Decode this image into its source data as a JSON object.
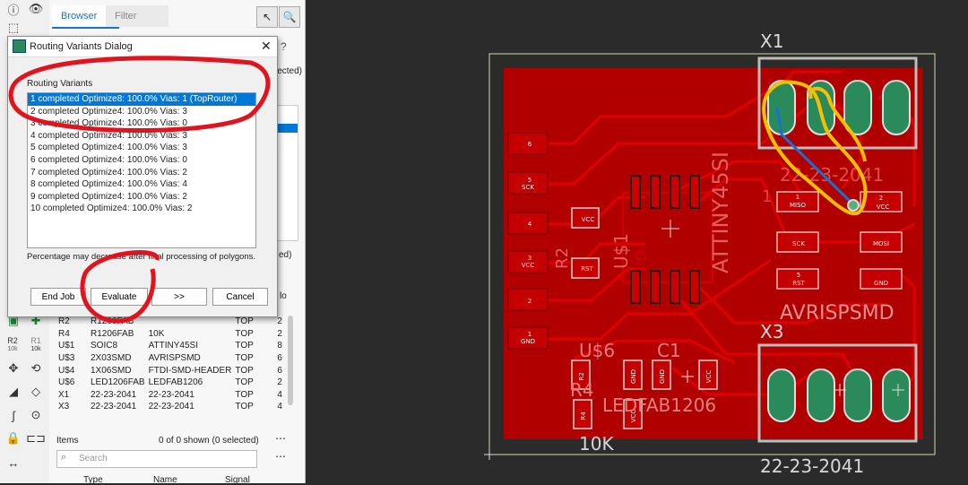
{
  "browser": {
    "tabs": [
      "Browser",
      "Filter"
    ],
    "partial_texts": {
      "selected": "lected)",
      "lines": "ed)",
      "lo": "lo"
    }
  },
  "parts_table": {
    "rows": [
      [
        "R2",
        "R1206FAB",
        "",
        "TOP",
        "2"
      ],
      [
        "R4",
        "R1206FAB",
        "10K",
        "TOP",
        "2"
      ],
      [
        "U$1",
        "SOIC8",
        "ATTINY45SI",
        "TOP",
        "8"
      ],
      [
        "U$3",
        "2X03SMD",
        "AVRISPSMD",
        "TOP",
        "6"
      ],
      [
        "U$4",
        "1X06SMD",
        "FTDI-SMD-HEADER",
        "TOP",
        "6"
      ],
      [
        "U$6",
        "LED1206FAB",
        "LEDFAB1206",
        "TOP",
        "2"
      ],
      [
        "X1",
        "22-23-2041",
        "22-23-2041",
        "TOP",
        "4"
      ],
      [
        "X3",
        "22-23-2041",
        "22-23-2041",
        "TOP",
        "4"
      ]
    ]
  },
  "items": {
    "label": "Items",
    "count": "0 of 0 shown (0 selected)",
    "search_placeholder": "Search",
    "columns": [
      "Type",
      "Name",
      "Signal"
    ]
  },
  "dialog": {
    "title": "Routing Variants Dialog",
    "group_label": "Routing Variants",
    "variants": [
      "1 completed Optimize8:  100.0%  Vias: 1 (TopRouter)",
      "2 completed Optimize4:  100.0%  Vias: 3",
      "3 completed Optimize4:  100.0%  Vias: 0",
      "4 completed Optimize4:  100.0%  Vias: 3",
      "5 completed Optimize4:  100.0%  Vias: 3",
      "6 completed Optimize4:  100.0%  Vias: 0",
      "7 completed Optimize4:  100.0%  Vias: 2",
      "8 completed Optimize4:  100.0%  Vias: 4",
      "9 completed Optimize4:  100.0%  Vias: 2",
      "10 completed Optimize4:  100.0%  Vias: 2"
    ],
    "note": "Percentage may decrease after final processing of polygons.",
    "buttons": {
      "end_job": "End Job",
      "evaluate": "Evaluate",
      "next": ">>",
      "cancel": "Cancel"
    }
  },
  "board_labels": {
    "x1": "X1",
    "x3": "X3",
    "x1_value": "22-23-2041",
    "x1_value_ghost": "22-23-2041",
    "avrisp": "AVRISPSMD",
    "attiny": "ATTINY45SI",
    "u1": "U$1",
    "u6": "U$6",
    "c1": "C1",
    "r2": "R2",
    "r4": "R4",
    "ledfab": "LEDFAB1206",
    "tenk": "10K",
    "one_ghost": "1"
  },
  "pads": {
    "ftdi": [
      "6",
      "5",
      "4",
      "3",
      "2",
      "1"
    ],
    "ftdi_names": [
      "",
      "SCK",
      "",
      "VCC",
      "",
      "GND"
    ],
    "avr": [
      "MISO",
      "VCC",
      "SCK",
      "MOSI",
      "RST",
      "GND"
    ],
    "avr_nums": [
      "1",
      "2",
      "",
      "",
      "5",
      ""
    ],
    "u1": [
      "VCC",
      "RST"
    ],
    "small": [
      "R2",
      "GND",
      "GND",
      "VCC",
      "R4",
      "VCC"
    ]
  },
  "toolbar_labels": {
    "r2": "R2",
    "r2_sub": "10k",
    "r1_sub": "10k"
  },
  "colors": {
    "board": "#b00000",
    "trace": "#e00000",
    "pad_green": "#2a8a5a",
    "annotation": "#e0141e",
    "highlight": "#f5c000",
    "wire": "#1a6fd0"
  }
}
